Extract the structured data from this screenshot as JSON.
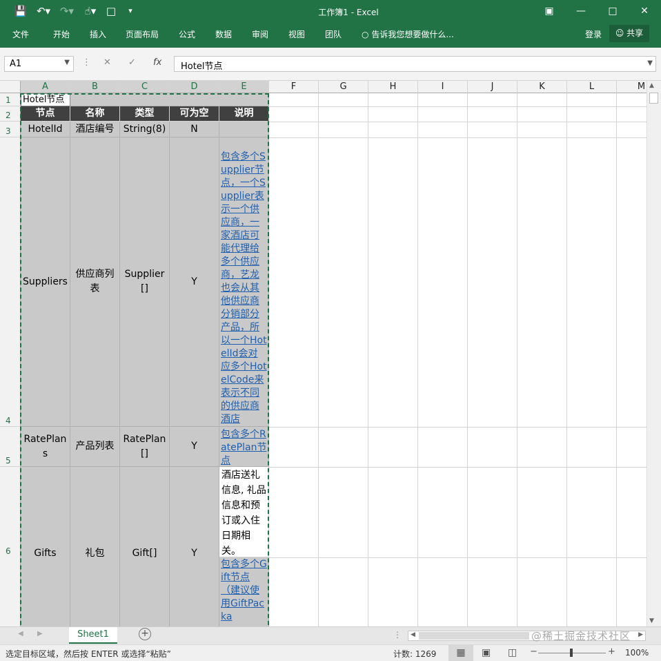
{
  "titlebar": {
    "title": "工作簿1 - Excel"
  },
  "ribbon": {
    "tabs": [
      "文件",
      "开始",
      "插入",
      "页面布局",
      "公式",
      "数据",
      "审阅",
      "视图",
      "团队"
    ],
    "tell_me": "告诉我您想要做什么...",
    "login": "登录",
    "share": "共享"
  },
  "formula_bar": {
    "name_box": "A1",
    "fx": "fx",
    "value": "Hotel节点"
  },
  "columns": [
    "A",
    "B",
    "C",
    "D",
    "E",
    "F",
    "G",
    "H",
    "I",
    "J",
    "K",
    "L",
    "M"
  ],
  "rows": [
    "1",
    "2",
    "3",
    "4",
    "5",
    "6"
  ],
  "cells": {
    "a1": "Hotel节点",
    "headers": [
      "节点",
      "名称",
      "类型",
      "可为空",
      "说明"
    ],
    "r3": [
      "HotelId",
      "酒店编号",
      "String(8)",
      "N",
      ""
    ],
    "r4": [
      "Suppliers",
      "供应商列表",
      "Supplier[]",
      "Y",
      "包含多个Supplier节点，一个Supplier表示一个供应商，一家酒店可能代理给多个供应商，艺龙也会从其他供应商分销部分产品，所以一个HotelId会对应多个HotelCode来表示不同的供应商酒店"
    ],
    "r5": [
      "RatePlans",
      "产品列表",
      "RatePlan[]",
      "Y",
      "包含多个RatePlan节点"
    ],
    "r6": [
      "Gifts",
      "礼包",
      "Gift[]",
      "Y",
      "酒店送礼信息, 礼品信息和预订或入住日期相关。",
      "包含多个Gift节点（建议使用GiftPacka"
    ]
  },
  "sheet": {
    "tab": "Sheet1"
  },
  "status": {
    "message": "选定目标区域，然后按 ENTER 或选择“粘贴”",
    "count": "计数: 1269",
    "zoom": "100%",
    "watermark": "@稀土掘金技术社区"
  }
}
